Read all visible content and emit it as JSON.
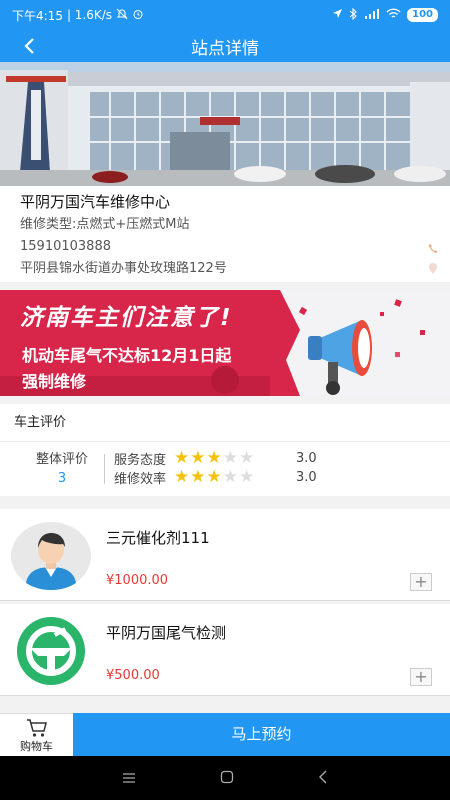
{
  "status_bar": {
    "time": "下午4:15",
    "speed": "| 1.6K/s",
    "battery": "100"
  },
  "header": {
    "title": "站点详情"
  },
  "station": {
    "name": "平阴万国汽车维修中心",
    "type": "维修类型:点燃式+压燃式M站",
    "phone": "15910103888",
    "address": "平阴县锦水街道办事处玫瑰路122号"
  },
  "banner": {
    "title": "济南车主们注意了!",
    "line1": "机动车尾气不达标12月1日起",
    "line2": "强制维修"
  },
  "reviews": {
    "section_title": "车主评价",
    "overall_label": "整体评价",
    "overall_value": "3",
    "items": [
      {
        "label": "服务态度",
        "stars": 3,
        "score": "3.0"
      },
      {
        "label": "维修效率",
        "stars": 3,
        "score": "3.0"
      }
    ]
  },
  "products": [
    {
      "name": "三元催化剂111",
      "price": "¥1000.00",
      "add": "+"
    },
    {
      "name": "平阴万国尾气检测",
      "price": "¥500.00",
      "add": "+"
    }
  ],
  "bottom": {
    "cart_label": "购物车",
    "book_label": "马上预约"
  },
  "colors": {
    "primary": "#2196f3",
    "price": "#e53935",
    "star": "#f4c20d",
    "banner": "#d7264a",
    "logo_green": "#2ab56a"
  }
}
